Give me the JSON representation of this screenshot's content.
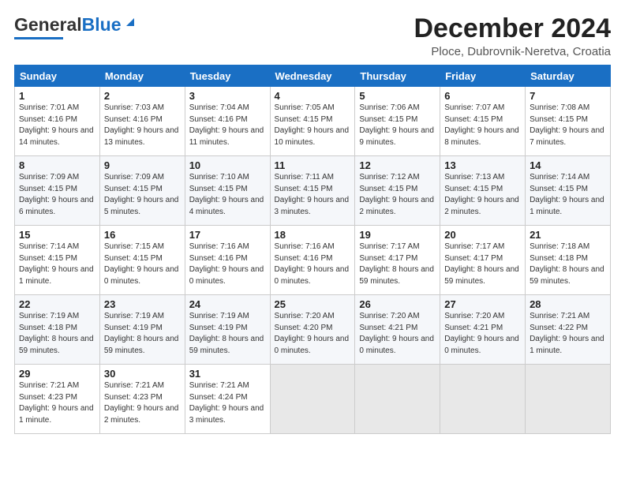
{
  "header": {
    "logo_general": "General",
    "logo_blue": "Blue",
    "month_title": "December 2024",
    "location": "Ploce, Dubrovnik-Neretva, Croatia"
  },
  "days": [
    "Sunday",
    "Monday",
    "Tuesday",
    "Wednesday",
    "Thursday",
    "Friday",
    "Saturday"
  ],
  "weeks": [
    [
      {
        "date": "1",
        "sunrise": "7:01 AM",
        "sunset": "4:16 PM",
        "daylight": "9 hours and 14 minutes."
      },
      {
        "date": "2",
        "sunrise": "7:03 AM",
        "sunset": "4:16 PM",
        "daylight": "9 hours and 13 minutes."
      },
      {
        "date": "3",
        "sunrise": "7:04 AM",
        "sunset": "4:16 PM",
        "daylight": "9 hours and 11 minutes."
      },
      {
        "date": "4",
        "sunrise": "7:05 AM",
        "sunset": "4:15 PM",
        "daylight": "9 hours and 10 minutes."
      },
      {
        "date": "5",
        "sunrise": "7:06 AM",
        "sunset": "4:15 PM",
        "daylight": "9 hours and 9 minutes."
      },
      {
        "date": "6",
        "sunrise": "7:07 AM",
        "sunset": "4:15 PM",
        "daylight": "9 hours and 8 minutes."
      },
      {
        "date": "7",
        "sunrise": "7:08 AM",
        "sunset": "4:15 PM",
        "daylight": "9 hours and 7 minutes."
      }
    ],
    [
      {
        "date": "8",
        "sunrise": "7:09 AM",
        "sunset": "4:15 PM",
        "daylight": "9 hours and 6 minutes."
      },
      {
        "date": "9",
        "sunrise": "7:09 AM",
        "sunset": "4:15 PM",
        "daylight": "9 hours and 5 minutes."
      },
      {
        "date": "10",
        "sunrise": "7:10 AM",
        "sunset": "4:15 PM",
        "daylight": "9 hours and 4 minutes."
      },
      {
        "date": "11",
        "sunrise": "7:11 AM",
        "sunset": "4:15 PM",
        "daylight": "9 hours and 3 minutes."
      },
      {
        "date": "12",
        "sunrise": "7:12 AM",
        "sunset": "4:15 PM",
        "daylight": "9 hours and 2 minutes."
      },
      {
        "date": "13",
        "sunrise": "7:13 AM",
        "sunset": "4:15 PM",
        "daylight": "9 hours and 2 minutes."
      },
      {
        "date": "14",
        "sunrise": "7:14 AM",
        "sunset": "4:15 PM",
        "daylight": "9 hours and 1 minute."
      }
    ],
    [
      {
        "date": "15",
        "sunrise": "7:14 AM",
        "sunset": "4:15 PM",
        "daylight": "9 hours and 1 minute."
      },
      {
        "date": "16",
        "sunrise": "7:15 AM",
        "sunset": "4:15 PM",
        "daylight": "9 hours and 0 minutes."
      },
      {
        "date": "17",
        "sunrise": "7:16 AM",
        "sunset": "4:16 PM",
        "daylight": "9 hours and 0 minutes."
      },
      {
        "date": "18",
        "sunrise": "7:16 AM",
        "sunset": "4:16 PM",
        "daylight": "9 hours and 0 minutes."
      },
      {
        "date": "19",
        "sunrise": "7:17 AM",
        "sunset": "4:17 PM",
        "daylight": "8 hours and 59 minutes."
      },
      {
        "date": "20",
        "sunrise": "7:17 AM",
        "sunset": "4:17 PM",
        "daylight": "8 hours and 59 minutes."
      },
      {
        "date": "21",
        "sunrise": "7:18 AM",
        "sunset": "4:18 PM",
        "daylight": "8 hours and 59 minutes."
      }
    ],
    [
      {
        "date": "22",
        "sunrise": "7:19 AM",
        "sunset": "4:18 PM",
        "daylight": "8 hours and 59 minutes."
      },
      {
        "date": "23",
        "sunrise": "7:19 AM",
        "sunset": "4:19 PM",
        "daylight": "8 hours and 59 minutes."
      },
      {
        "date": "24",
        "sunrise": "7:19 AM",
        "sunset": "4:19 PM",
        "daylight": "8 hours and 59 minutes."
      },
      {
        "date": "25",
        "sunrise": "7:20 AM",
        "sunset": "4:20 PM",
        "daylight": "9 hours and 0 minutes."
      },
      {
        "date": "26",
        "sunrise": "7:20 AM",
        "sunset": "4:21 PM",
        "daylight": "9 hours and 0 minutes."
      },
      {
        "date": "27",
        "sunrise": "7:20 AM",
        "sunset": "4:21 PM",
        "daylight": "9 hours and 0 minutes."
      },
      {
        "date": "28",
        "sunrise": "7:21 AM",
        "sunset": "4:22 PM",
        "daylight": "9 hours and 1 minute."
      }
    ],
    [
      {
        "date": "29",
        "sunrise": "7:21 AM",
        "sunset": "4:23 PM",
        "daylight": "9 hours and 1 minute."
      },
      {
        "date": "30",
        "sunrise": "7:21 AM",
        "sunset": "4:23 PM",
        "daylight": "9 hours and 2 minutes."
      },
      {
        "date": "31",
        "sunrise": "7:21 AM",
        "sunset": "4:24 PM",
        "daylight": "9 hours and 3 minutes."
      },
      null,
      null,
      null,
      null
    ]
  ]
}
